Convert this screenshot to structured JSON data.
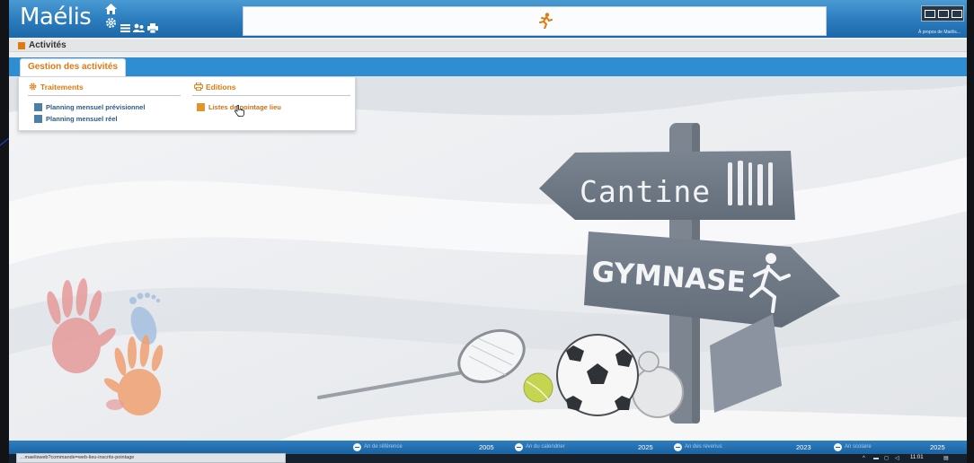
{
  "app": {
    "logo": "Maélis",
    "about_link": "À propos de Maélis..."
  },
  "header": {
    "icons": [
      "home-icon",
      "gear-icon",
      "menu-icon",
      "users-icon",
      "printer-icon"
    ],
    "center_icon": "runner-icon",
    "window_icons": [
      "window-icon",
      "window-icon",
      "window-icon"
    ]
  },
  "breadcrumb": {
    "title": "Activités"
  },
  "tabs": [
    {
      "label": "Gestion des activités",
      "active": true
    }
  ],
  "menu": {
    "columns": [
      {
        "header": "Traitements",
        "icon": "gear-icon",
        "items": [
          {
            "label": "Planning mensuel prévisionnel"
          },
          {
            "label": "Planning mensuel réel"
          }
        ]
      },
      {
        "header": "Editions",
        "icon": "printer-icon",
        "items": [
          {
            "label": "Listes de pointage lieu"
          }
        ]
      }
    ]
  },
  "scene": {
    "signs": [
      "Cantine",
      "GYMNASE"
    ]
  },
  "footer": {
    "items": [
      {
        "label": "An de référence",
        "value": "2005"
      },
      {
        "label": "An du calendrier",
        "value": "2025"
      },
      {
        "label": "An des revenus",
        "value": "2023"
      },
      {
        "label": "An scolaire",
        "value": "2025"
      }
    ]
  },
  "status_bar": {
    "url": "…maelisweb?commande=web-lieu-inscrits-pointage"
  },
  "taskbar": {
    "time": "11:01"
  },
  "colors": {
    "header_blue": "#2a7bbd",
    "band_blue": "#2f8dd2",
    "accent_orange": "#e07a10",
    "menu_item_blue": "#2b5a86"
  }
}
